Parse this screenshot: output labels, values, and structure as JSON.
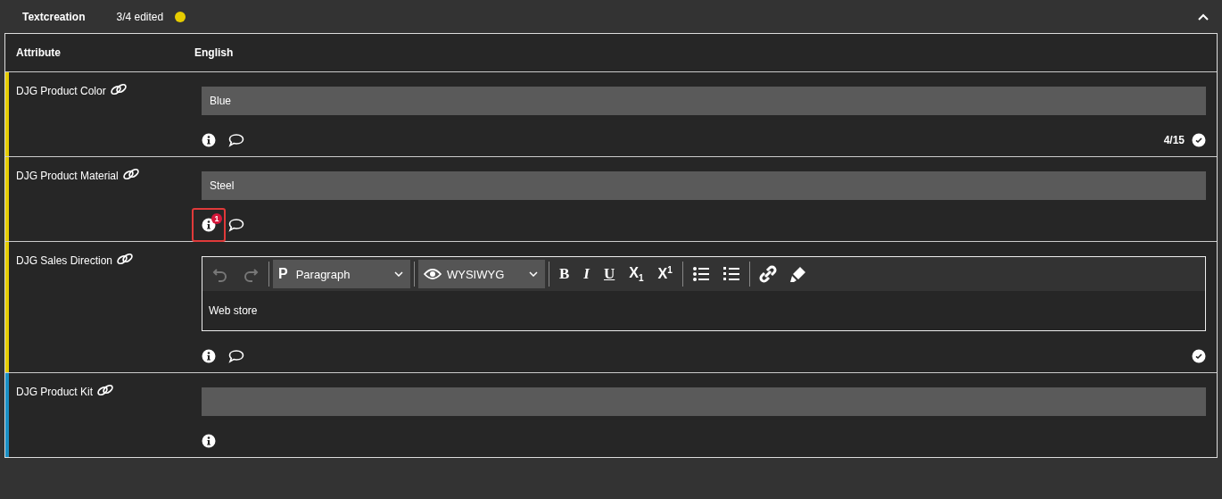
{
  "section": {
    "title": "Textcreation",
    "status": "3/4 edited",
    "expanded": true
  },
  "table": {
    "columns": [
      "Attribute",
      "English"
    ],
    "rows": [
      {
        "name": "DJG Product Color",
        "color": "#e6cc00",
        "kind": "input",
        "value": "Blue",
        "comment": true,
        "highlighted": false,
        "counter": "4/15",
        "validated": true
      },
      {
        "name": "DJG Product Material",
        "color": "#e6cc00",
        "kind": "input",
        "value": "Steel",
        "comment": true,
        "info_badge": "1",
        "highlighted": true,
        "validated": false
      },
      {
        "name": "DJG Sales Direction",
        "color": "#e6cc00",
        "kind": "richtext",
        "value": "Web store",
        "comment": true,
        "highlighted": false,
        "validated": true,
        "toolbar": {
          "format_icon": "P",
          "format": "Paragraph",
          "mode": "WYSIWYG",
          "marks": [
            "B",
            "I",
            "U",
            "X$_{1}$",
            "X$^{1}$"
          ]
        }
      },
      {
        "name": "DJG Product Kit",
        "color": "#1a8fc4",
        "kind": "input",
        "comment": false,
        "highlighted": false,
        "validated": false
      }
    ]
  }
}
